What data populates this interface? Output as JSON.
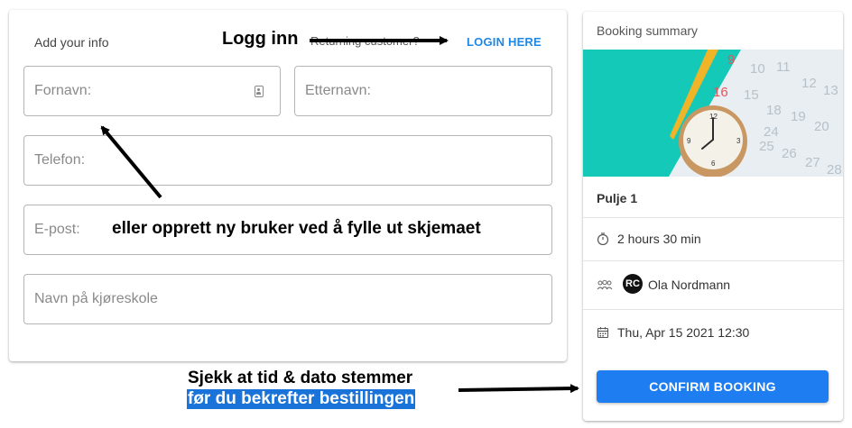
{
  "form": {
    "heading": "Add your info",
    "returning_label": "Returning customer?",
    "login_link": "LOGIN HERE",
    "fields": {
      "first_name_placeholder": "Fornavn:",
      "last_name_placeholder": "Etternavn:",
      "phone_placeholder": "Telefon:",
      "email_placeholder": "E-post:",
      "school_placeholder": "Navn på kjøreskole"
    }
  },
  "summary": {
    "title": "Booking summary",
    "pool_name": "Pulje 1",
    "duration": "2 hours 30 min",
    "instructor_initials": "RC",
    "instructor": "Ola Nordmann",
    "datetime": "Thu, Apr 15 2021 12:30",
    "confirm_label": "CONFIRM BOOKING"
  },
  "annotations": {
    "login": "Logg inn",
    "register": "eller opprett ny bruker ved å fylle ut skjemaet",
    "check_line1": "Sjekk at tid & dato stemmer",
    "check_line2": "før du bekrefter bestillingen"
  },
  "colors": {
    "accent": "#1e7df0",
    "link": "#1e88e5",
    "highlight": "#1a73d9"
  },
  "icons": [
    "contact-card-icon",
    "timer-icon",
    "people-icon",
    "calendar-icon",
    "arrow-icon"
  ]
}
